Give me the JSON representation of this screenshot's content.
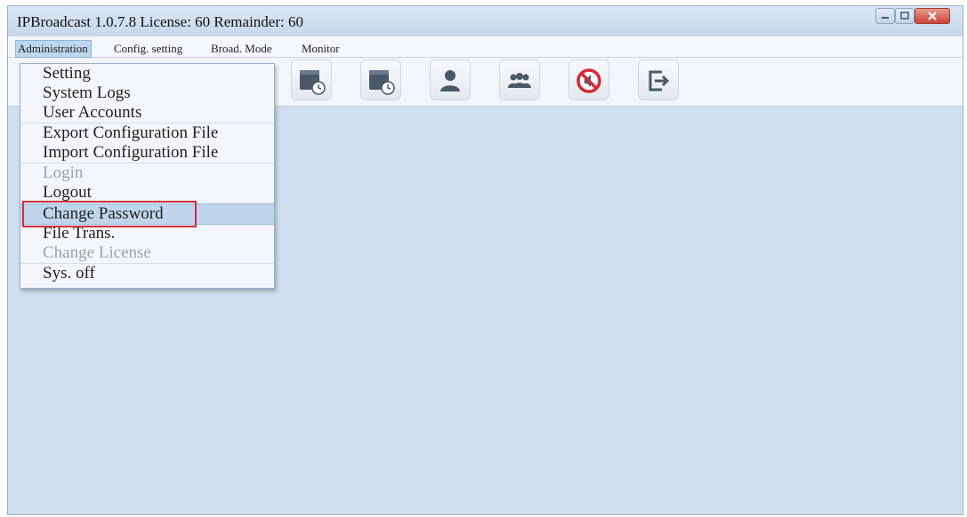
{
  "window": {
    "title": "IPBroadcast 1.0.7.8 License: 60 Remainder: 60"
  },
  "menubar": {
    "items": [
      {
        "label": "Administration"
      },
      {
        "label": "Config. setting"
      },
      {
        "label": "Broad. Mode"
      },
      {
        "label": "Monitor"
      }
    ]
  },
  "toolbar": {
    "buttons": [
      {
        "icon": "schedule-clock-icon"
      },
      {
        "icon": "schedule-clock-icon"
      },
      {
        "icon": "user-icon"
      },
      {
        "icon": "users-group-icon"
      },
      {
        "icon": "mute-icon"
      },
      {
        "icon": "exit-icon"
      }
    ]
  },
  "dropdown": {
    "items": [
      {
        "label": "Setting",
        "disabled": false
      },
      {
        "label": "System Logs",
        "disabled": false
      },
      {
        "label": "User Accounts",
        "disabled": false
      },
      {
        "label": "Export Configuration File",
        "disabled": false
      },
      {
        "label": "Import Configuration File",
        "disabled": false
      },
      {
        "label": "Login",
        "disabled": true
      },
      {
        "label": "Logout",
        "disabled": false
      },
      {
        "label": "Change Password",
        "disabled": false,
        "highlighted": true
      },
      {
        "label": "File Trans.",
        "disabled": false
      },
      {
        "label": "Change License",
        "disabled": true
      },
      {
        "label": "Sys. off",
        "disabled": false
      }
    ]
  },
  "colors": {
    "workspace": "#cfdff0",
    "highlight": "#bfd5ec",
    "annotation_box": "#d0303a",
    "mute_red": "#d62a34"
  }
}
